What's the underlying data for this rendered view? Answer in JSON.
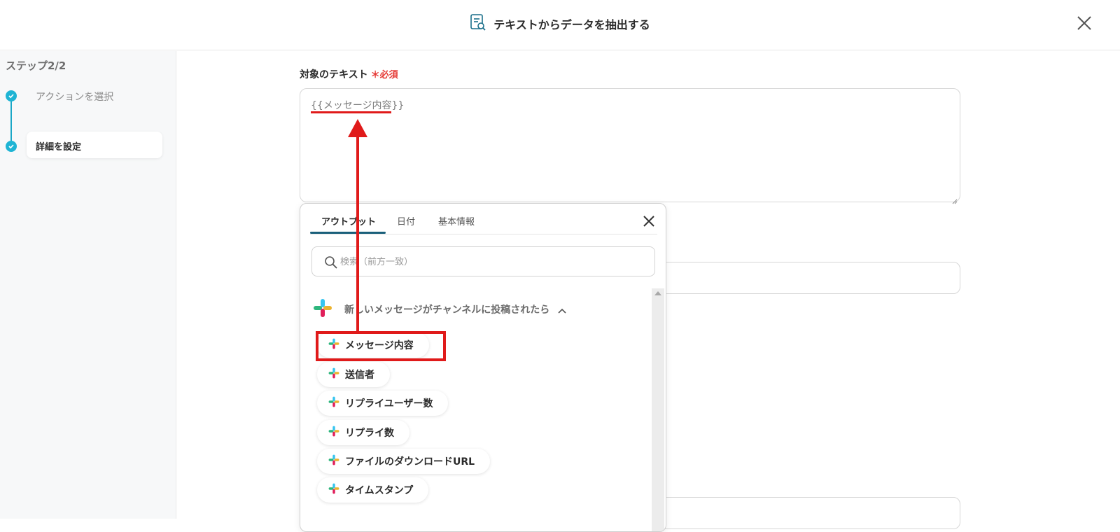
{
  "header": {
    "title": "テキストからデータを抽出する"
  },
  "sidebar": {
    "step_count": "ステップ2/2",
    "steps": [
      {
        "label": "アクションを選択"
      },
      {
        "label": "詳細を設定"
      }
    ]
  },
  "form": {
    "field_label": "対象のテキスト",
    "required_mark": "＊必須",
    "textarea_value": "{{メッセージ内容}}"
  },
  "popup": {
    "tabs": [
      {
        "label": "アウトプット"
      },
      {
        "label": "日付"
      },
      {
        "label": "基本情報"
      }
    ],
    "active_tab": "アウトプット",
    "search_placeholder": "検索（前方一致）",
    "group_title": "新しいメッセージがチャンネルに投稿されたら",
    "items": [
      {
        "label": "メッセージ内容"
      },
      {
        "label": "送信者"
      },
      {
        "label": "リプライユーザー数"
      },
      {
        "label": "リプライ数"
      },
      {
        "label": "ファイルのダウンロードURL"
      },
      {
        "label": "タイムスタンプ"
      }
    ]
  },
  "colors": {
    "accent": "#1eb4d4",
    "annotation_red": "#e01a1a",
    "tab_underline": "#1a5f7a"
  },
  "icons": [
    "document-search-icon",
    "close-icon",
    "check-icon",
    "search-icon",
    "slack-icon",
    "chevron-up-icon"
  ]
}
